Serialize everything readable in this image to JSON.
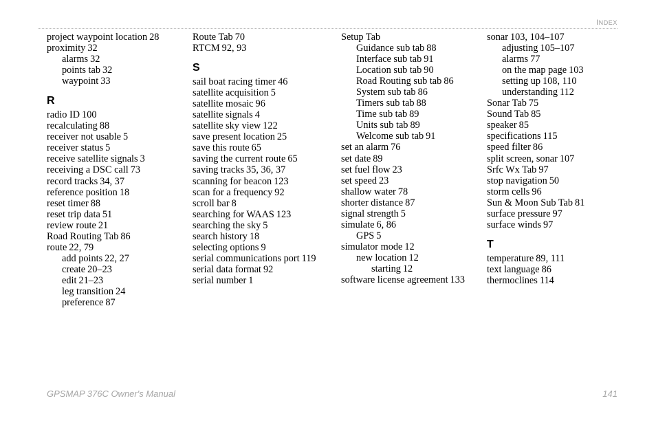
{
  "header": {
    "section_label": "Index"
  },
  "footer": {
    "manual_title": "GPSMAP 376C Owner's Manual",
    "page_number": "141"
  },
  "columns": [
    {
      "id": "column-1",
      "blocks": [
        {
          "type": "entries",
          "entries": [
            {
              "text": "project waypoint location",
              "pages": "28",
              "level": 0
            },
            {
              "text": "proximity",
              "pages": "32",
              "level": 0
            },
            {
              "text": "alarms",
              "pages": "32",
              "level": 1
            },
            {
              "text": "points tab",
              "pages": "32",
              "level": 1
            },
            {
              "text": "waypoint",
              "pages": "33",
              "level": 1
            }
          ]
        },
        {
          "type": "heading",
          "letter": "R"
        },
        {
          "type": "entries",
          "entries": [
            {
              "text": "radio ID",
              "pages": "100",
              "level": 0
            },
            {
              "text": "recalculating",
              "pages": "88",
              "level": 0
            },
            {
              "text": "receiver not usable",
              "pages": "5",
              "level": 0
            },
            {
              "text": "receiver status",
              "pages": "5",
              "level": 0
            },
            {
              "text": "receive satellite signals",
              "pages": "3",
              "level": 0
            },
            {
              "text": "receiving a DSC call",
              "pages": "73",
              "level": 0
            },
            {
              "text": "record tracks",
              "pages": "34, 37",
              "level": 0
            },
            {
              "text": "reference position",
              "pages": "18",
              "level": 0
            },
            {
              "text": "reset timer",
              "pages": "88",
              "level": 0
            },
            {
              "text": "reset trip data",
              "pages": "51",
              "level": 0
            },
            {
              "text": "review route",
              "pages": "21",
              "level": 0
            },
            {
              "text": "Road Routing Tab",
              "pages": "86",
              "level": 0
            },
            {
              "text": "route",
              "pages": "22, 79",
              "level": 0
            },
            {
              "text": "add points",
              "pages": "22, 27",
              "level": 1
            },
            {
              "text": "create",
              "pages": "20–23",
              "level": 1
            },
            {
              "text": "edit",
              "pages": "21–23",
              "level": 1
            },
            {
              "text": "leg transition",
              "pages": "24",
              "level": 1
            },
            {
              "text": "preference",
              "pages": "87",
              "level": 1
            }
          ]
        }
      ]
    },
    {
      "id": "column-2",
      "blocks": [
        {
          "type": "entries",
          "entries": [
            {
              "text": "Route Tab",
              "pages": "70",
              "level": 0
            },
            {
              "text": "RTCM",
              "pages": "92, 93",
              "level": 0
            }
          ]
        },
        {
          "type": "heading",
          "letter": "S"
        },
        {
          "type": "entries",
          "entries": [
            {
              "text": "sail boat racing timer",
              "pages": "46",
              "level": 0
            },
            {
              "text": "satellite acquisition",
              "pages": "5",
              "level": 0
            },
            {
              "text": "satellite mosaic",
              "pages": "96",
              "level": 0
            },
            {
              "text": "satellite signals",
              "pages": "4",
              "level": 0
            },
            {
              "text": "satellite sky view",
              "pages": "122",
              "level": 0
            },
            {
              "text": "save present location",
              "pages": "25",
              "level": 0
            },
            {
              "text": "save this route",
              "pages": "65",
              "level": 0
            },
            {
              "text": "saving the current route",
              "pages": "65",
              "level": 0
            },
            {
              "text": "saving tracks",
              "pages": "35, 36, 37",
              "level": 0
            },
            {
              "text": "scanning for beacon",
              "pages": "123",
              "level": 0
            },
            {
              "text": "scan for a frequency",
              "pages": "92",
              "level": 0
            },
            {
              "text": "scroll bar",
              "pages": "8",
              "level": 0
            },
            {
              "text": "searching for WAAS",
              "pages": "123",
              "level": 0
            },
            {
              "text": "searching the sky",
              "pages": "5",
              "level": 0
            },
            {
              "text": "search history",
              "pages": "18",
              "level": 0
            },
            {
              "text": "selecting options",
              "pages": "9",
              "level": 0
            },
            {
              "text": "serial communications port",
              "pages": "119",
              "level": 0
            },
            {
              "text": "serial data format",
              "pages": "92",
              "level": 0
            },
            {
              "text": "serial number",
              "pages": "1",
              "level": 0
            }
          ]
        }
      ]
    },
    {
      "id": "column-3",
      "blocks": [
        {
          "type": "entries",
          "entries": [
            {
              "text": "Setup Tab",
              "pages": "",
              "level": 0
            },
            {
              "text": "Guidance sub tab",
              "pages": "88",
              "level": 1
            },
            {
              "text": "Interface sub tab",
              "pages": "91",
              "level": 1
            },
            {
              "text": "Location sub tab",
              "pages": "90",
              "level": 1
            },
            {
              "text": "Road Routing sub tab",
              "pages": "86",
              "level": 1
            },
            {
              "text": "System sub tab",
              "pages": "86",
              "level": 1
            },
            {
              "text": "Timers sub tab",
              "pages": "88",
              "level": 1
            },
            {
              "text": "Time sub tab",
              "pages": "89",
              "level": 1
            },
            {
              "text": "Units sub tab",
              "pages": "89",
              "level": 1
            },
            {
              "text": "Welcome sub tab",
              "pages": "91",
              "level": 1
            },
            {
              "text": "set an alarm",
              "pages": "76",
              "level": 0
            },
            {
              "text": "set date",
              "pages": "89",
              "level": 0
            },
            {
              "text": "set fuel flow",
              "pages": "23",
              "level": 0
            },
            {
              "text": "set speed",
              "pages": "23",
              "level": 0
            },
            {
              "text": "shallow water",
              "pages": "78",
              "level": 0
            },
            {
              "text": "shorter distance",
              "pages": "87",
              "level": 0
            },
            {
              "text": "signal strength",
              "pages": "5",
              "level": 0
            },
            {
              "text": "simulate",
              "pages": "6, 86",
              "level": 0
            },
            {
              "text": "GPS",
              "pages": "5",
              "level": 1
            },
            {
              "text": "simulator mode",
              "pages": "12",
              "level": 0
            },
            {
              "text": "new location",
              "pages": "12",
              "level": 1
            },
            {
              "text": "starting",
              "pages": "12",
              "level": 2
            },
            {
              "text": "software license agreement",
              "pages": "133",
              "level": 0
            }
          ]
        }
      ]
    },
    {
      "id": "column-4",
      "blocks": [
        {
          "type": "entries",
          "entries": [
            {
              "text": "sonar",
              "pages": "103, 104–107",
              "level": 0
            },
            {
              "text": "adjusting",
              "pages": "105–107",
              "level": 1
            },
            {
              "text": "alarms",
              "pages": "77",
              "level": 1
            },
            {
              "text": "on the map page",
              "pages": "103",
              "level": 1
            },
            {
              "text": "setting up",
              "pages": "108, 110",
              "level": 1
            },
            {
              "text": "understanding",
              "pages": "112",
              "level": 1
            },
            {
              "text": "Sonar Tab",
              "pages": "75",
              "level": 0
            },
            {
              "text": "Sound Tab",
              "pages": "85",
              "level": 0
            },
            {
              "text": "speaker",
              "pages": "85",
              "level": 0
            },
            {
              "text": "specifications",
              "pages": "115",
              "level": 0
            },
            {
              "text": "speed filter",
              "pages": "86",
              "level": 0
            },
            {
              "text": "split screen, sonar",
              "pages": "107",
              "level": 0
            },
            {
              "text": "Srfc Wx Tab",
              "pages": "97",
              "level": 0
            },
            {
              "text": "stop navigation",
              "pages": "50",
              "level": 0
            },
            {
              "text": "storm cells",
              "pages": "96",
              "level": 0
            },
            {
              "text": "Sun & Moon Sub Tab",
              "pages": "81",
              "level": 0
            },
            {
              "text": "surface pressure",
              "pages": "97",
              "level": 0
            },
            {
              "text": "surface winds",
              "pages": "97",
              "level": 0
            }
          ]
        },
        {
          "type": "heading",
          "letter": "T"
        },
        {
          "type": "entries",
          "entries": [
            {
              "text": "temperature",
              "pages": "89, 111",
              "level": 0
            },
            {
              "text": "text language",
              "pages": "86",
              "level": 0
            },
            {
              "text": "thermoclines",
              "pages": "114",
              "level": 0
            }
          ]
        }
      ]
    }
  ]
}
